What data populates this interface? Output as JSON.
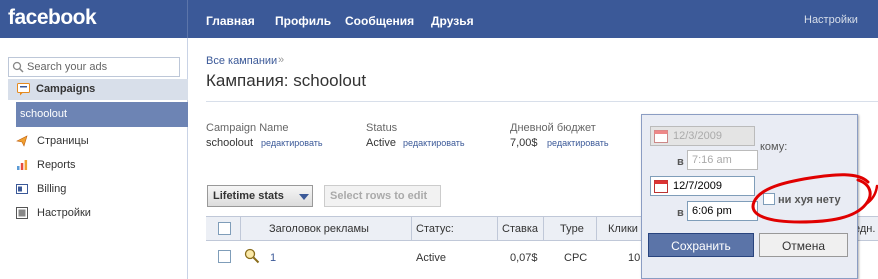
{
  "header": {
    "logo": "facebook",
    "nav": [
      "Главная",
      "Профиль",
      "Сообщения",
      "Друзья"
    ],
    "settings": "Настройки"
  },
  "sidebar": {
    "search_placeholder": "Search your ads",
    "campaigns_label": "Campaigns",
    "active_campaign": "schoolout",
    "items": [
      {
        "label": "Страницы",
        "icon": "pages-icon"
      },
      {
        "label": "Reports",
        "icon": "reports-icon"
      },
      {
        "label": "Billing",
        "icon": "billing-icon"
      },
      {
        "label": "Настройки",
        "icon": "settings-icon"
      }
    ]
  },
  "main": {
    "breadcrumb": "Все кампании",
    "breadcrumb_sep": "»",
    "title_prefix": "Кампания:",
    "title_name": "schoolout",
    "info": {
      "name_label": "Campaign Name",
      "name_value": "schoolout",
      "status_label": "Status",
      "status_value": "Active",
      "budget_label": "Дневной бюджет",
      "budget_value": "7,00$",
      "edit_label": "редактировать"
    },
    "lifetime_button": "Lifetime stats",
    "select_rows_button": "Select rows to edit",
    "table": {
      "headers": [
        "Заголовок рекламы",
        "Статус:",
        "Ставка",
        "Type",
        "Клики",
        "едн."
      ],
      "rows": [
        {
          "title": "1",
          "status": "Active",
          "bid": "0,07$",
          "type": "CPC",
          "clicks": "10"
        }
      ]
    }
  },
  "popup": {
    "start_date": "12/3/2009",
    "start_time": "7:16 am",
    "end_date": "12/7/2009",
    "end_time": "6:06 pm",
    "v_label": "в",
    "komu_label": "кому:",
    "none_label": "ни хуя нету",
    "save": "Сохранить",
    "cancel": "Отмена"
  },
  "colors": {
    "brand": "#3b5998",
    "sidebar_active": "#6d84b4",
    "annotation": "#e00000"
  }
}
